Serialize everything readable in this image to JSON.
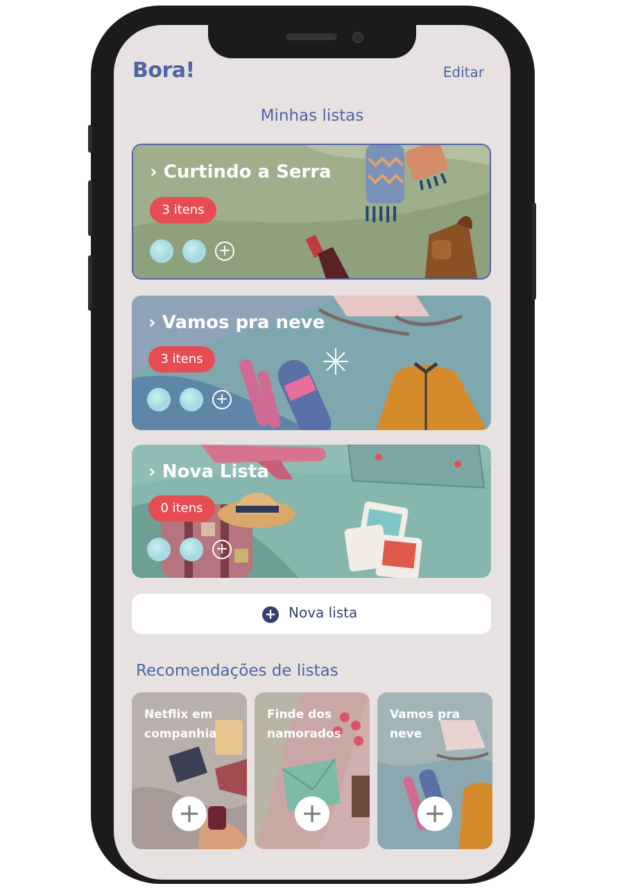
{
  "app": {
    "title": "Bora!",
    "edit_label": "Editar"
  },
  "lists_section": {
    "title": "Minhas listas"
  },
  "lists": [
    {
      "title": "› Curtindo a Serra",
      "badge": "3 itens",
      "add_member": "+"
    },
    {
      "title": "› Vamos pra neve",
      "badge": "3 itens",
      "add_member": "+"
    },
    {
      "title": "› Nova Lista",
      "badge": "0 itens",
      "add_member": "+"
    }
  ],
  "new_list": {
    "icon": "+",
    "label": "Nova lista"
  },
  "recommendations": {
    "title": "Recomendações de listas",
    "items": [
      {
        "label": "Netflix em companhia",
        "add": "+"
      },
      {
        "label": "Finde dos namorados",
        "add": "+"
      },
      {
        "label": "Vamos pra neve",
        "add": "+"
      }
    ]
  },
  "colors": {
    "brand": "#4f64a6",
    "badge": "#e64c52",
    "background": "#e7e2e1",
    "button_dark": "#34416e"
  }
}
